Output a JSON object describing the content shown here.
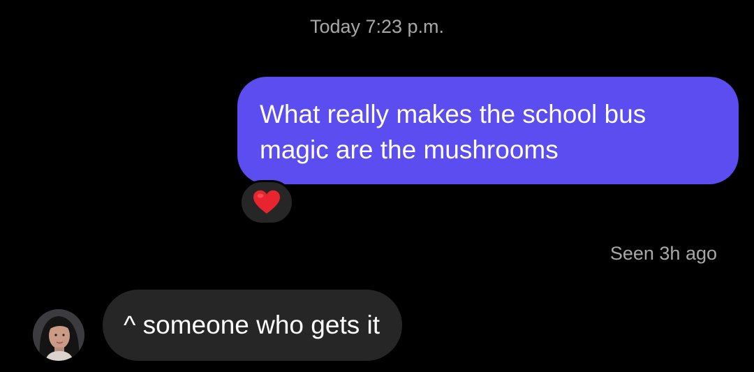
{
  "thread": {
    "timestamp": "Today 7:23 p.m.",
    "seen_status": "Seen 3h ago"
  },
  "messages": [
    {
      "direction": "outgoing",
      "text": "What really makes the school bus magic are the mushrooms",
      "reaction": {
        "icon": "red-heart-icon",
        "color": "#e8252f"
      }
    },
    {
      "direction": "incoming",
      "text": "^ someone who gets it",
      "avatar": "avatar"
    }
  ],
  "colors": {
    "background": "#000000",
    "outgoing_bubble": "#5b4df0",
    "incoming_bubble": "#262626",
    "meta_text": "#a8a8a8"
  }
}
